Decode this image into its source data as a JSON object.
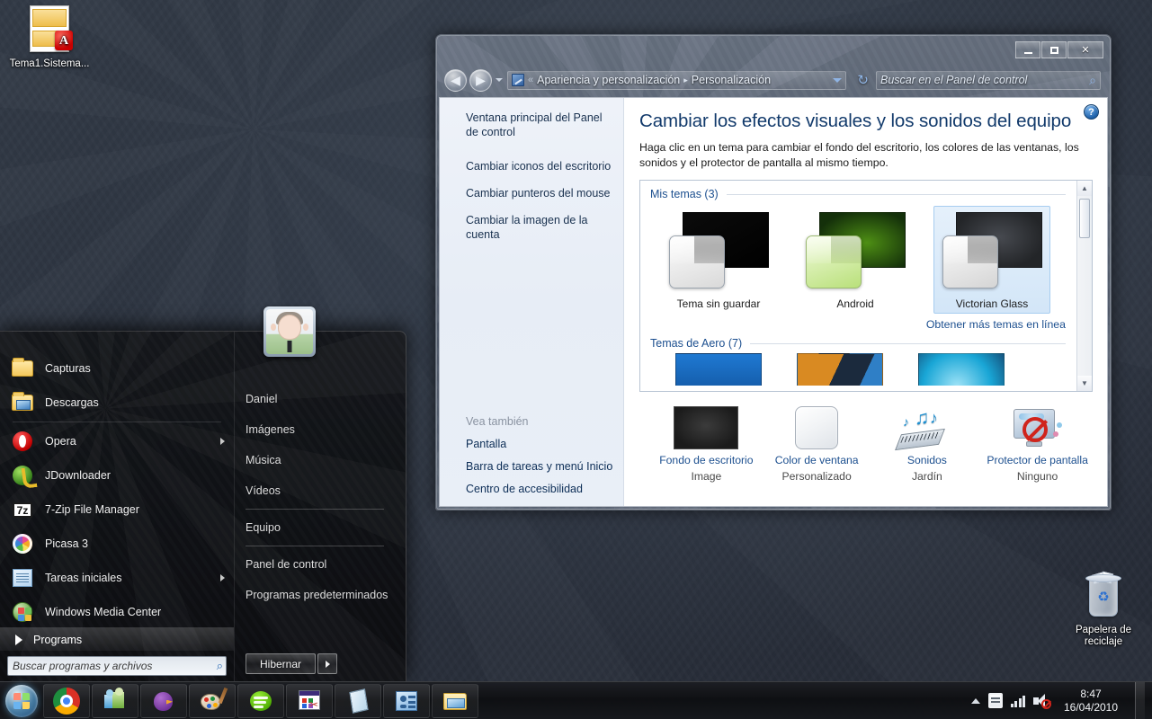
{
  "desktop": {
    "icons": [
      {
        "name": "Tema1.Sistema...",
        "icon": "pdf-document-icon"
      },
      {
        "name": "Papelera de reciclaje",
        "icon": "recycle-bin-icon"
      }
    ]
  },
  "window": {
    "controls": {
      "minimize": "minimize-icon",
      "maximize": "maximize-icon",
      "close": "✕"
    },
    "nav": {
      "back": "◀",
      "forward": "▶",
      "recent_pages": "history-dropdown-icon"
    },
    "address": {
      "chevron": "«",
      "breadcrumbs": [
        "Apariencia y personalización",
        "Personalización"
      ],
      "separator": "▸",
      "dropdown": "address-dropdown-icon",
      "refresh": "↻"
    },
    "search": {
      "placeholder": "Buscar en el Panel de control",
      "value": "",
      "icon": "⌕"
    },
    "help": "?"
  },
  "taskpane": {
    "links": [
      "Ventana principal del Panel de control",
      "Cambiar iconos del escritorio",
      "Cambiar punteros del mouse",
      "Cambiar la imagen de la cuenta"
    ],
    "see_also": {
      "title": "Vea también",
      "links": [
        "Pantalla",
        "Barra de tareas y menú Inicio",
        "Centro de accesibilidad"
      ]
    }
  },
  "main": {
    "title": "Cambiar los efectos visuales y los sonidos del equipo",
    "subtitle": "Haga clic en un tema para cambiar el fondo del escritorio, los colores de las ventanas, los sonidos y el protector de pantalla al mismo tiempo.",
    "groups": [
      {
        "title": "Mis temas (3)",
        "count": 3
      },
      {
        "title": "Temas de Aero (7)",
        "count": 7
      }
    ],
    "themes": [
      {
        "label": "Tema sin guardar",
        "selected": false,
        "bg": "#000000",
        "bg2": "#0a0a0a",
        "win": "#f2f2f2"
      },
      {
        "label": "Android",
        "selected": false,
        "bg": "#2c5c0a",
        "bg2": "#143003",
        "win": "#dff2b8"
      },
      {
        "label": "Victorian Glass",
        "selected": true,
        "bg": "#3a3d42",
        "bg2": "#24262a",
        "win": "#f0f0f0"
      }
    ],
    "aero_previews": [
      "#1f6fc4",
      "#c1640f",
      "#1fa8d8"
    ],
    "more_themes_link": "Obtener más temas en línea",
    "settings": [
      {
        "name": "Fondo de escritorio",
        "value": "Image",
        "icon": "wallpaper-icon"
      },
      {
        "name": "Color de ventana",
        "value": "Personalizado",
        "icon": "window-color-icon"
      },
      {
        "name": "Sonidos",
        "value": "Jardín",
        "icon": "sounds-icon"
      },
      {
        "name": "Protector de pantalla",
        "value": "Ninguno",
        "icon": "screensaver-icon"
      }
    ]
  },
  "startmenu": {
    "left_items": [
      {
        "label": "Capturas",
        "icon": "folder-icon",
        "submenu": false
      },
      {
        "label": "Descargas",
        "icon": "folder-download-icon",
        "submenu": false
      },
      {
        "label": "Opera",
        "icon": "opera-icon",
        "submenu": true
      },
      {
        "label": "JDownloader",
        "icon": "jdownloader-icon",
        "submenu": false
      },
      {
        "label": "7-Zip File Manager",
        "icon": "sevenzip-icon",
        "submenu": false
      },
      {
        "label": "Picasa 3",
        "icon": "picasa-icon",
        "submenu": false
      },
      {
        "label": "Tareas iniciales",
        "icon": "getting-started-icon",
        "submenu": true
      },
      {
        "label": "Windows Media Center",
        "icon": "media-center-icon",
        "submenu": false
      }
    ],
    "all_programs": "Programs",
    "search": {
      "placeholder": "Buscar programas y archivos",
      "value": "",
      "icon": "⌕"
    },
    "user": "Daniel",
    "right_items": [
      "Daniel",
      "Imágenes",
      "Música",
      "Vídeos",
      "Equipo",
      "Panel de control",
      "Programas predeterminados"
    ],
    "power": {
      "label": "Hibernar",
      "more": "power-options-arrow"
    }
  },
  "taskbar": {
    "start": "start-orb-icon",
    "buttons": [
      {
        "name": "Google Chrome",
        "icon": "chrome-icon"
      },
      {
        "name": "Windows Live Messenger",
        "icon": "messenger-icon"
      },
      {
        "name": "Twitter client",
        "icon": "bird-icon"
      },
      {
        "name": "Paint",
        "icon": "paint-icon"
      },
      {
        "name": "Spotify",
        "icon": "spotify-icon"
      },
      {
        "name": "Recortes",
        "icon": "snipping-tool-icon"
      },
      {
        "name": "Bloc de notas",
        "icon": "notepad-icon"
      },
      {
        "name": "Personalización",
        "icon": "personalization-icon"
      },
      {
        "name": "Explorador de Windows",
        "icon": "explorer-icon"
      }
    ],
    "tray": {
      "show_hidden": "show-hidden-icons-arrow",
      "action_center": "action-center-flag-icon",
      "network": "network-signal-icon",
      "volume": "volume-muted-icon",
      "time": "8:47",
      "date": "16/04/2010"
    }
  }
}
